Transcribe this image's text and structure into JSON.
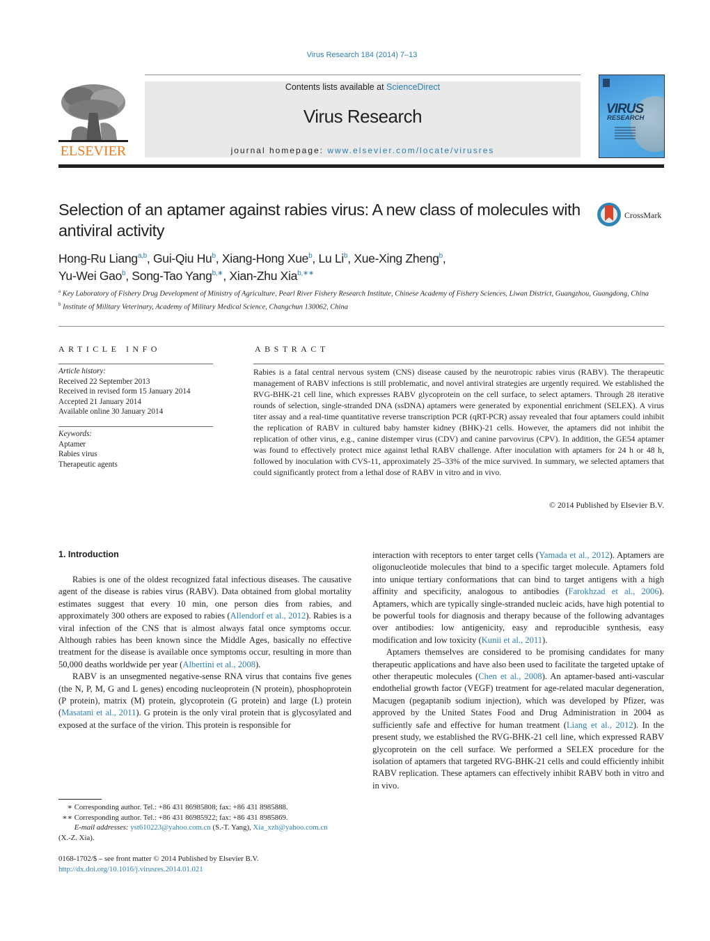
{
  "header": {
    "journal_ref": "Virus Research 184 (2014) 7–13",
    "contents_prefix": "Contents lists available at ",
    "contents_link": "ScienceDirect",
    "journal_name": "Virus Research",
    "homepage_prefix": "journal homepage: ",
    "homepage_link": "www.elsevier.com/locate/virusres",
    "publisher_logo": "ELSEVIER",
    "cover_title_1": "VIRUS",
    "cover_title_2": "RESEARCH",
    "brand_color": "#f27a1a",
    "link_color": "#2a7fb0"
  },
  "article": {
    "title": "Selection of an aptamer against rabies virus: A new class of molecules with antiviral activity",
    "crossmark_label": "CrossMark",
    "authors": [
      {
        "name": "Hong-Ru Liang",
        "sup": "a,b",
        "sep": ", "
      },
      {
        "name": "Gui-Qiu Hu",
        "sup": "b",
        "sep": ", "
      },
      {
        "name": "Xiang-Hong Xue",
        "sup": "b",
        "sep": ", "
      },
      {
        "name": "Lu Li",
        "sup": "b",
        "sep": ", "
      },
      {
        "name": "Xue-Xing Zheng",
        "sup": "b",
        "sep": ","
      },
      {
        "name": "Yu-Wei Gao",
        "sup": "b",
        "sep": ", "
      },
      {
        "name": "Song-Tao Yang",
        "sup": "b,∗",
        "sep": ", "
      },
      {
        "name": "Xian-Zhu Xia",
        "sup": "b,∗∗",
        "sep": ""
      }
    ],
    "affiliations": [
      {
        "mark": "a",
        "text": "Key Laboratory of Fishery Drug Development of Ministry of Agriculture, Pearl River Fishery Research Institute, Chinese Academy of Fishery Sciences, Liwan District, Guangzhou, Guangdong, China"
      },
      {
        "mark": "b",
        "text": "Institute of Military Veterinary, Academy of Military Medical Science, Changchun 130062, China"
      }
    ]
  },
  "article_info": {
    "heading": "ARTICLE INFO",
    "history_label": "Article history:",
    "history": [
      "Received 22 September 2013",
      "Received in revised form 15 January 2014",
      "Accepted 21 January 2014",
      "Available online 30 January 2014"
    ],
    "keywords_label": "Keywords:",
    "keywords": [
      "Aptamer",
      "Rabies virus",
      "Therapeutic agents"
    ]
  },
  "abstract": {
    "heading": "ABSTRACT",
    "text": "Rabies is a fatal central nervous system (CNS) disease caused by the neurotropic rabies virus (RABV). The therapeutic management of RABV infections is still problematic, and novel antiviral strategies are urgently required. We established the RVG-BHK-21 cell line, which expresses RABV glycoprotein on the cell surface, to select aptamers. Through 28 iterative rounds of selection, single-stranded DNA (ssDNA) aptamers were generated by exponential enrichment (SELEX). A virus titer assay and a real-time quantitative reverse transcription PCR (qRT-PCR) assay revealed that four aptamers could inhibit the replication of RABV in cultured baby hamster kidney (BHK)-21 cells. However, the aptamers did not inhibit the replication of other virus, e.g., canine distemper virus (CDV) and canine parvovirus (CPV). In addition, the GE54 aptamer was found to effectively protect mice against lethal RABV challenge. After inoculation with aptamers for 24 h or 48 h, followed by inoculation with CVS-11, approximately 25–33% of the mice survived. In summary, we selected aptamers that could significantly protect from a lethal dose of RABV in vitro and in vivo.",
    "copyright": "© 2014 Published by Elsevier B.V."
  },
  "body": {
    "section_heading": "1.  Introduction",
    "left_paragraphs": [
      [
        {
          "t": "Rabies is one of the oldest recognized fatal infectious diseases. The causative agent of the disease is rabies virus (RABV). Data obtained from global mortality estimates suggest that every 10 min, one person dies from rabies, and approximately 300 others are exposed to rabies ("
        },
        {
          "t": "Allendorf et al., 2012",
          "link": true
        },
        {
          "t": "). Rabies is a viral infection of the CNS that is almost always fatal once symptoms occur. Although rabies has been known since the Middle Ages, basically no effective treatment for the disease is available once symptoms occur, resulting in more than 50,000 deaths worldwide per year ("
        },
        {
          "t": "Albertini et al., 2008",
          "link": true
        },
        {
          "t": ")."
        }
      ],
      [
        {
          "t": "RABV is an unsegmented negative-sense RNA virus that contains five genes (the N, P, M, G and L genes) encoding nucleoprotein (N protein), phosphoprotein (P protein), matrix (M) protein, glycoprotein (G protein) and large (L) protein ("
        },
        {
          "t": "Masatani et al., 2011",
          "link": true
        },
        {
          "t": "). G protein is the only viral protein that is glycosylated and exposed at the surface of the virion. This protein is responsible for"
        }
      ]
    ],
    "right_paragraphs": [
      [
        {
          "t": "interaction with receptors to enter target cells ("
        },
        {
          "t": "Yamada et al., 2012",
          "link": true
        },
        {
          "t": "). Aptamers are oligonucleotide molecules that bind to a specific target molecule. Aptamers fold into unique tertiary conformations that can bind to target antigens with a high affinity and specificity, analogous to antibodies ("
        },
        {
          "t": "Farokhzad et al., 2006",
          "link": true
        },
        {
          "t": "). Aptamers, which are typically single-stranded nucleic acids, have high potential to be powerful tools for diagnosis and therapy because of the following advantages over antibodies: low antigenicity, easy and reproducible synthesis, easy modification and low toxicity ("
        },
        {
          "t": "Kunii et al., 2011",
          "link": true
        },
        {
          "t": ")."
        }
      ],
      [
        {
          "t": "Aptamers themselves are considered to be promising candidates for many therapeutic applications and have also been used to facilitate the targeted uptake of other therapeutic molecules ("
        },
        {
          "t": "Chen et al., 2008",
          "link": true
        },
        {
          "t": "). An aptamer-based anti-vascular endothelial growth factor (VEGF) treatment for age-related macular degeneration, Macugen (pegaptanib sodium injection), which was developed by Pfizer, was approved by the United States Food and Drug Administration in 2004 as sufficiently safe and effective for human treatment ("
        },
        {
          "t": "Liang et al., 2012",
          "link": true
        },
        {
          "t": "). In the present study, we established the RVG-BHK-21 cell line, which expressed RABV glycoprotein on the cell surface. We performed a SELEX procedure for the isolation of aptamers that targeted RVG-BHK-21 cells and could efficiently inhibit RABV replication. These aptamers can effectively inhibit RABV both in vitro and in vivo."
        }
      ]
    ]
  },
  "footnotes": {
    "items": [
      {
        "mark": "∗",
        "text": "Corresponding author. Tel.: +86 431 86985808; fax: +86 431 8985888."
      },
      {
        "mark": "∗∗",
        "text": "Corresponding author. Tel.: +86 431 86985922; fax: +86 431 8985869."
      }
    ],
    "email_label": "E-mail addresses:",
    "email_1": "yst610223@yahoo.com.cn",
    "email_1_owner": " (S.-T. Yang), ",
    "email_2": "Xia_xzh@yahoo.com.cn",
    "email_2_owner": "(X.-Z. Xia).",
    "front_matter": "0168-1702/$ – see front matter © 2014 Published by Elsevier B.V.",
    "doi": "http://dx.doi.org/10.1016/j.virusres.2014.01.021"
  }
}
